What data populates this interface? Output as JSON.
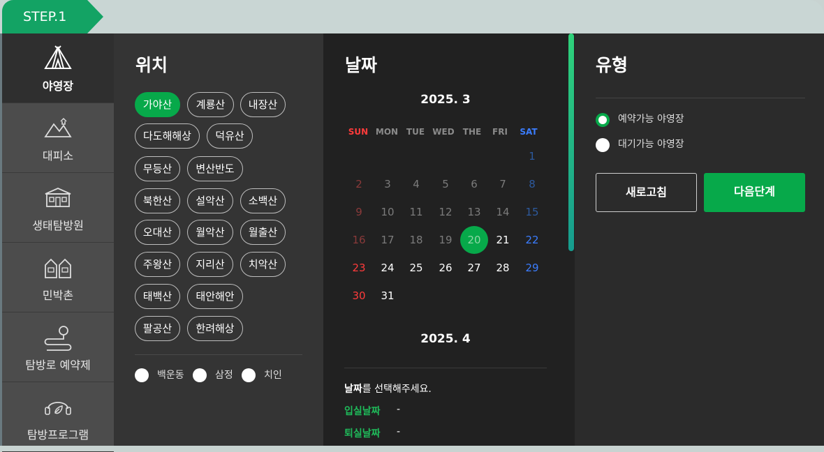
{
  "step": "STEP.1",
  "sidebar": {
    "items": [
      {
        "label": "야영장",
        "icon": "tent-icon"
      },
      {
        "label": "대피소",
        "icon": "mountain-shelter-icon"
      },
      {
        "label": "생태탐방원",
        "icon": "eco-center-icon"
      },
      {
        "label": "민박촌",
        "icon": "houses-icon"
      },
      {
        "label": "탐방로 예약제",
        "icon": "trail-route-icon"
      },
      {
        "label": "탐방프로그램",
        "icon": "program-leaf-icon"
      }
    ]
  },
  "location": {
    "title": "위치",
    "chips": [
      "가야산",
      "계룡산",
      "내장산",
      "다도해해상",
      "덕유산",
      "무등산",
      "변산반도",
      "북한산",
      "설악산",
      "소백산",
      "오대산",
      "월악산",
      "월출산",
      "주왕산",
      "지리산",
      "치악산",
      "태백산",
      "태안해안",
      "팔공산",
      "한려해상"
    ],
    "selected": "가야산",
    "subs": [
      "백운동",
      "삼정",
      "치인"
    ]
  },
  "date": {
    "title": "날짜",
    "months": [
      "2025. 3",
      "2025. 4"
    ],
    "weekdays": [
      "SUN",
      "MON",
      "TUE",
      "WED",
      "THE",
      "FRI",
      "SAT"
    ],
    "days": [
      "1",
      "2",
      "3",
      "4",
      "5",
      "6",
      "7",
      "8",
      "9",
      "10",
      "11",
      "12",
      "13",
      "14",
      "15",
      "16",
      "17",
      "18",
      "19",
      "20",
      "21",
      "22",
      "23",
      "24",
      "25",
      "26",
      "27",
      "28",
      "29",
      "30",
      "31"
    ],
    "today": "20",
    "prompt_bold": "날짜",
    "prompt_rest": "를 선택해주세요.",
    "checkin_label": "입실날짜",
    "checkin_value": "-",
    "checkout_label": "퇴실날짜",
    "checkout_value": "-"
  },
  "type": {
    "title": "유형",
    "options": [
      "예약가능 야영장",
      "대기가능 야영장"
    ],
    "selected": "예약가능 야영장",
    "refresh_label": "새로고침",
    "next_label": "다음단계"
  },
  "colors": {
    "accent": "#07a94a",
    "sunday": "#ff3b3b",
    "saturday": "#3b7dff"
  }
}
